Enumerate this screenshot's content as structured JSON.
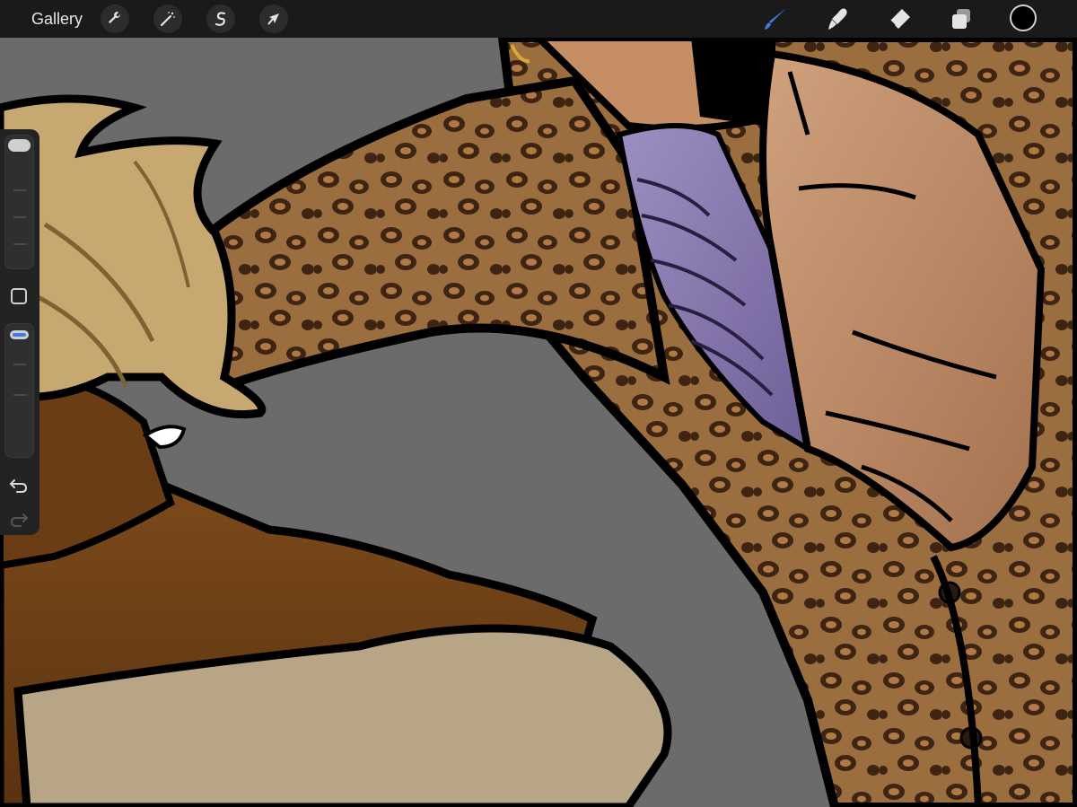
{
  "toolbar": {
    "gallery_label": "Gallery",
    "left_tools": [
      "wrench-icon",
      "magic-wand-icon",
      "selection-s-icon",
      "transform-arrow-icon"
    ],
    "right_tools": [
      "brush-icon",
      "smudge-icon",
      "eraser-icon",
      "layers-icon"
    ],
    "active_tool": "brush-icon",
    "active_color": "#000000",
    "accent": "#3f7be8"
  },
  "sidebar": {
    "brush_size": 0.96,
    "opacity": 1.0,
    "undo_enabled": true,
    "redo_enabled": false
  },
  "canvas": {
    "background": "#6b6b6b",
    "leopard_base": "#9a6e3e",
    "skin_light": "#b98560",
    "skin_dark": "#6a3d15",
    "hair": "#c7a870",
    "purple_shirt": "#8b7bb0",
    "dress": "#b7a586"
  }
}
